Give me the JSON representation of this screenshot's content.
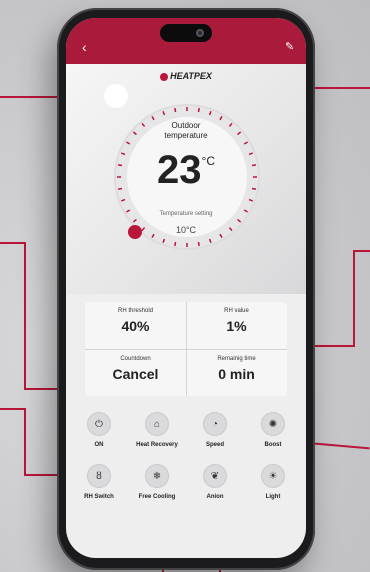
{
  "app": {
    "brand": "HEATPEX"
  },
  "nav": {
    "back_icon": "chevron-left-icon",
    "edit_icon": "edit-icon"
  },
  "dial": {
    "title_line1": "Outdoor",
    "title_line2": "temperature",
    "temperature": "23",
    "temperature_unit": "°C",
    "setting_label": "Temperature setting",
    "setting_value": "10°C",
    "accent": "#b8163b"
  },
  "stats": {
    "rh_threshold_label": "RH threshold",
    "rh_threshold_value": "40%",
    "rh_value_label": "RH value",
    "rh_value": "1%",
    "countdown_label": "Countdown",
    "countdown_value": "Cancel",
    "remaining_label": "Remainig time",
    "remaining_value": "0 min"
  },
  "controls": [
    {
      "label": "ON",
      "icon": "power-icon"
    },
    {
      "label": "Heat Recovery",
      "icon": "heat-recovery-icon"
    },
    {
      "label": "Speed",
      "icon": "speed-icon"
    },
    {
      "label": "Boost",
      "icon": "fan-icon"
    },
    {
      "label": "RH Switch",
      "icon": "humidity-icon"
    },
    {
      "label": "Free Cooling",
      "icon": "snowflake-icon"
    },
    {
      "label": "Anion",
      "icon": "leaf-icon"
    },
    {
      "label": "Light",
      "icon": "light-icon"
    }
  ],
  "colors": {
    "header": "#a91a3b",
    "callout": "#b8163b"
  }
}
